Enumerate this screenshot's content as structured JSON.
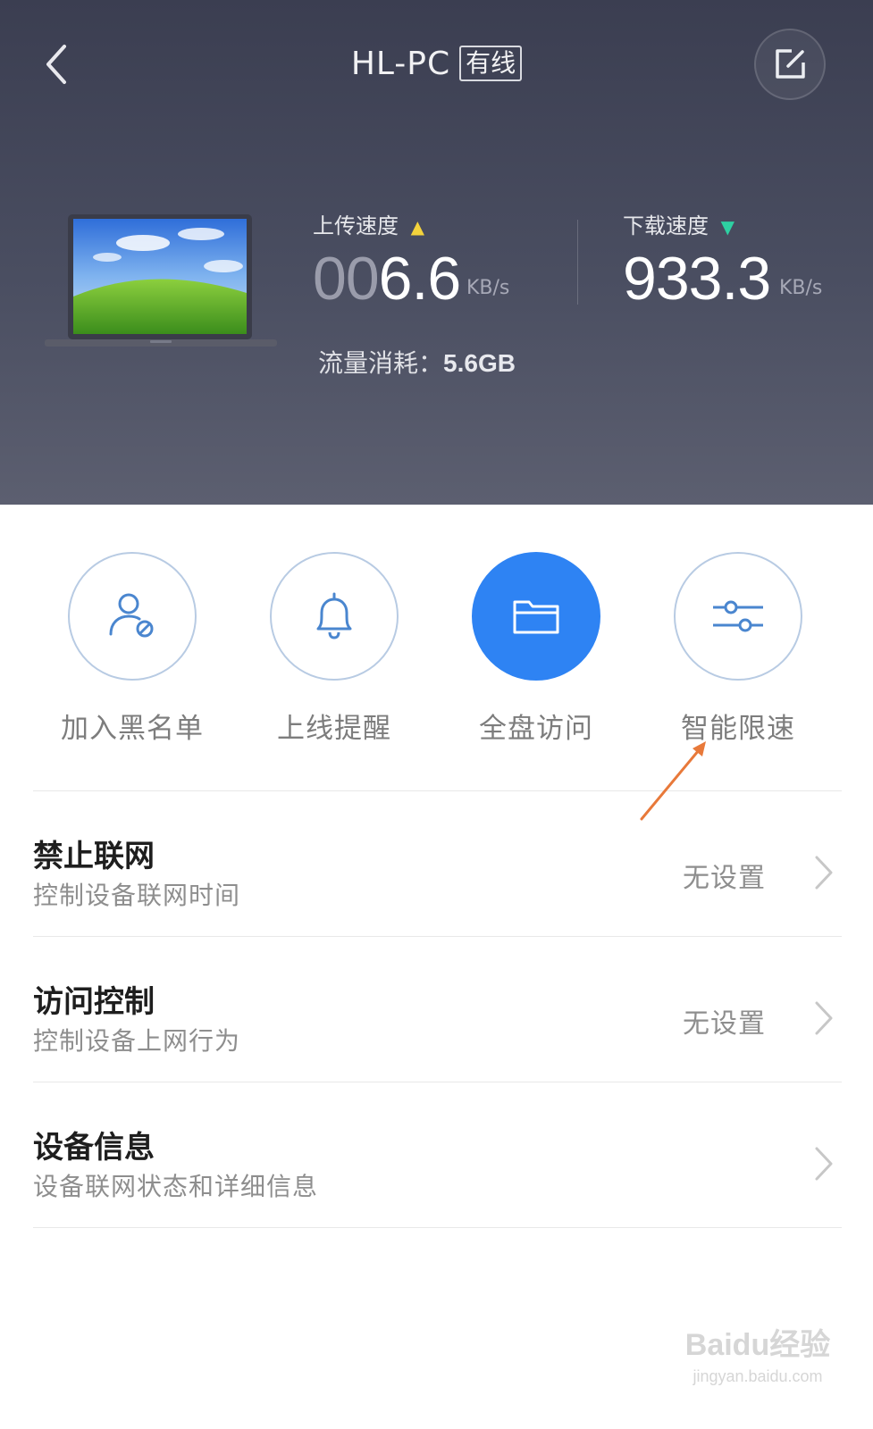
{
  "header": {
    "title": "HL-PC",
    "badge": "有线",
    "back_icon": "chevron-left-icon",
    "edit_icon": "edit-icon"
  },
  "stats": {
    "upload": {
      "label": "上传速度",
      "indicator": "▲",
      "value_dim": "00",
      "value_bright": "6.6",
      "unit": "KB/s",
      "color": "#f4d33c"
    },
    "download": {
      "label": "下载速度",
      "indicator": "▼",
      "value": "933.3",
      "unit": "KB/s",
      "color": "#2ed0a2"
    },
    "traffic_label": "流量消耗：",
    "traffic_value": "5.6GB"
  },
  "actions": [
    {
      "label": "加入黑名单",
      "icon": "user-block-icon",
      "active": false
    },
    {
      "label": "上线提醒",
      "icon": "bell-icon",
      "active": false
    },
    {
      "label": "全盘访问",
      "icon": "folder-icon",
      "active": true
    },
    {
      "label": "智能限速",
      "icon": "sliders-icon",
      "active": false
    }
  ],
  "settings": [
    {
      "title": "禁止联网",
      "subtitle": "控制设备联网时间",
      "status": "无设置"
    },
    {
      "title": "访问控制",
      "subtitle": "控制设备上网行为",
      "status": "无设置"
    },
    {
      "title": "设备信息",
      "subtitle": "设备联网状态和详细信息",
      "status": ""
    }
  ],
  "watermark": {
    "main": "Baidu经验",
    "url": "jingyan.baidu.com"
  },
  "colors": {
    "accent": "#2e83f3",
    "header_bg": "#45485b",
    "annotation_arrow": "#e8793a"
  }
}
